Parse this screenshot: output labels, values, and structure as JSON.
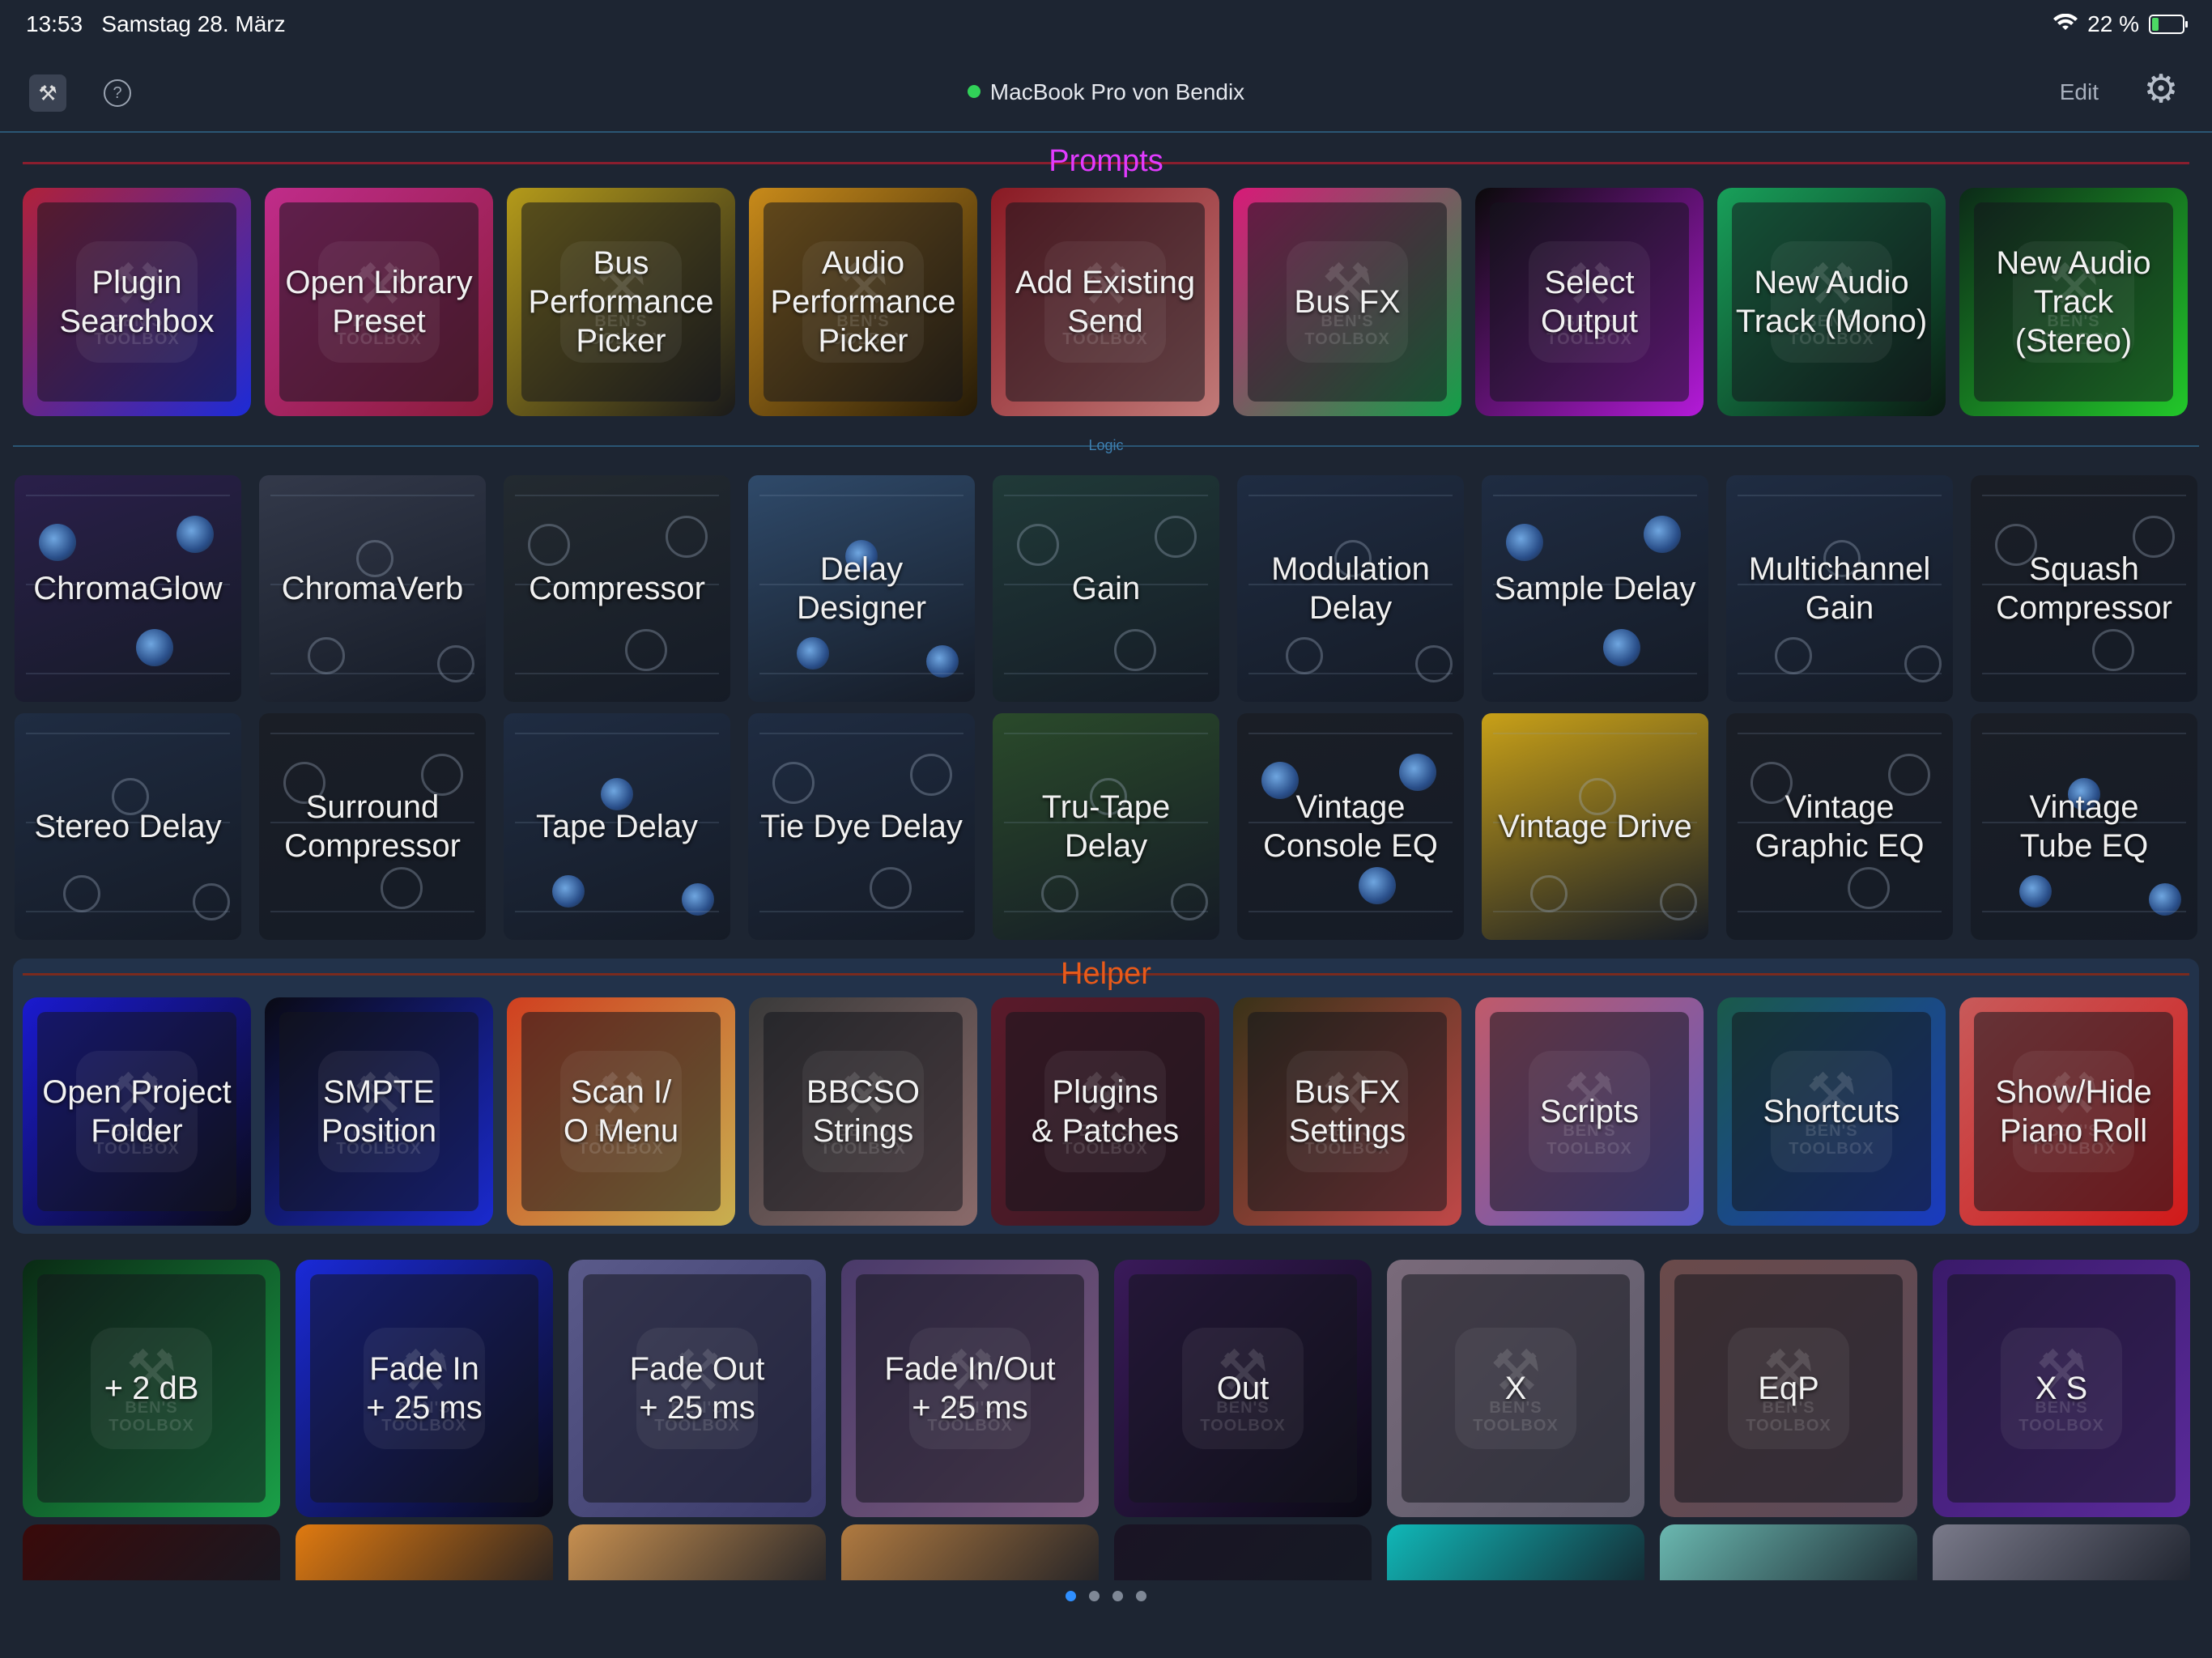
{
  "status_bar": {
    "time": "13:53",
    "date": "Samstag 28. März",
    "battery": "22 %",
    "battery_level": 0.22
  },
  "nav": {
    "device": "MacBook Pro von Bendix",
    "edit": "Edit",
    "help": "?"
  },
  "sections": {
    "prompts": {
      "title": "Prompts",
      "color": "#e23bff"
    },
    "logic": {
      "title": "Logic",
      "color": "#3d7fb0"
    },
    "helper": {
      "title": "Helper",
      "color": "#e85a1a"
    }
  },
  "watermark": "BEN'S\nTOOLBOX",
  "prompts": [
    {
      "label": "Plugin\nSearchbox",
      "from": "#b0213a",
      "to": "#1d2bd6"
    },
    {
      "label": "Open Library\nPreset",
      "from": "#c02c8a",
      "to": "#8a1c3a"
    },
    {
      "label": "Bus\nPerformance\nPicker",
      "from": "#b49a1a",
      "to": "#1a1a1a"
    },
    {
      "label": "Audio\nPerformance\nPicker",
      "from": "#c88a1a",
      "to": "#241a08"
    },
    {
      "label": "Add Existing\nSend",
      "from": "#8a1a24",
      "to": "#c07a78"
    },
    {
      "label": "Bus FX",
      "from": "#d81a78",
      "to": "#12a048"
    },
    {
      "label": "Select\nOutput",
      "from": "#0a0a0a",
      "to": "#b31ad8"
    },
    {
      "label": "New Audio\nTrack (Mono)",
      "from": "#18a05a",
      "to": "#0a1a12"
    },
    {
      "label": "New Audio\nTrack\n(Stereo)",
      "from": "#0c2a18",
      "to": "#22c82a"
    }
  ],
  "plugins_row1": [
    {
      "label": "ChromaGlow",
      "bg": "#2a1f4a"
    },
    {
      "label": "ChromaVerb",
      "bg": "#33394a"
    },
    {
      "label": "Compressor",
      "bg": "#232a30"
    },
    {
      "label": "Delay\nDesigner",
      "bg": "#2f4a6a"
    },
    {
      "label": "Gain",
      "bg": "#203a38"
    },
    {
      "label": "Modulation\nDelay",
      "bg": "#1f2c42"
    },
    {
      "label": "Sample Delay",
      "bg": "#1f2c42"
    },
    {
      "label": "Multichannel\nGain",
      "bg": "#1f2c42"
    },
    {
      "label": "Squash\nCompressor",
      "bg": "#1a1e26"
    }
  ],
  "plugins_row2": [
    {
      "label": "Stereo Delay",
      "bg": "#1f2c42"
    },
    {
      "label": "Surround\nCompressor",
      "bg": "#1a1e26"
    },
    {
      "label": "Tape Delay",
      "bg": "#1f2c42"
    },
    {
      "label": "Tie Dye Delay",
      "bg": "#1f2c42"
    },
    {
      "label": "Tru-Tape\nDelay",
      "bg": "#2a4a2a"
    },
    {
      "label": "Vintage\nConsole EQ",
      "bg": "#1a1e26"
    },
    {
      "label": "Vintage Drive",
      "bg": "#c8a018"
    },
    {
      "label": "Vintage\nGraphic EQ",
      "bg": "#1a1e26"
    },
    {
      "label": "Vintage\nTube EQ",
      "bg": "#1a1e26"
    }
  ],
  "helper": [
    {
      "label": "Open Project\nFolder",
      "from": "#1a1ad0",
      "to": "#0a0a14"
    },
    {
      "label": "SMPTE\nPosition",
      "from": "#0a0a14",
      "to": "#1a2ad0"
    },
    {
      "label": "Scan I/\nO Menu",
      "from": "#d04020",
      "to": "#c8b050"
    },
    {
      "label": "BBCSO\nStrings",
      "from": "#3a3a3a",
      "to": "#8a6a6a"
    },
    {
      "label": "Plugins\n& Patches",
      "from": "#5a1a2a",
      "to": "#3a1a24"
    },
    {
      "label": "Bus FX\nSettings",
      "from": "#3a3218",
      "to": "#c04848"
    },
    {
      "label": "Scripts",
      "from": "#c05a6a",
      "to": "#5a5ac8"
    },
    {
      "label": "Shortcuts",
      "from": "#1a5a4a",
      "to": "#1a3ac0"
    },
    {
      "label": "Show/Hide\nPiano Roll",
      "from": "#c85a5a",
      "to": "#d01a1a"
    }
  ],
  "bottom_row": [
    {
      "label": "+ 2 dB",
      "from": "#0a2a14",
      "to": "#1aa048"
    },
    {
      "label": "Fade In\n+ 25 ms",
      "from": "#1a2ad8",
      "to": "#0a0a14"
    },
    {
      "label": "Fade Out\n+ 25 ms",
      "from": "#5a5a8a",
      "to": "#3a3a6a"
    },
    {
      "label": "Fade In/Out\n+ 25 ms",
      "from": "#4a3a6a",
      "to": "#7a5a7a"
    },
    {
      "label": "Out",
      "from": "#3a1a5a",
      "to": "#0a0a14"
    },
    {
      "label": "X",
      "from": "#7a6a7a",
      "to": "#5a5a6a"
    },
    {
      "label": "EqP",
      "from": "#6a4a4a",
      "to": "#5a4a5a"
    },
    {
      "label": "X S",
      "from": "#3a1a6a",
      "to": "#5a2a9a"
    }
  ],
  "partial_row": [
    "#3a0a0a",
    "#e07a10",
    "#c89050",
    "#b07a40",
    "#1a1424",
    "#10b8b8",
    "#6ab8b0",
    "#7a7a8a"
  ],
  "pagination": {
    "pages": 4,
    "current": 1
  }
}
